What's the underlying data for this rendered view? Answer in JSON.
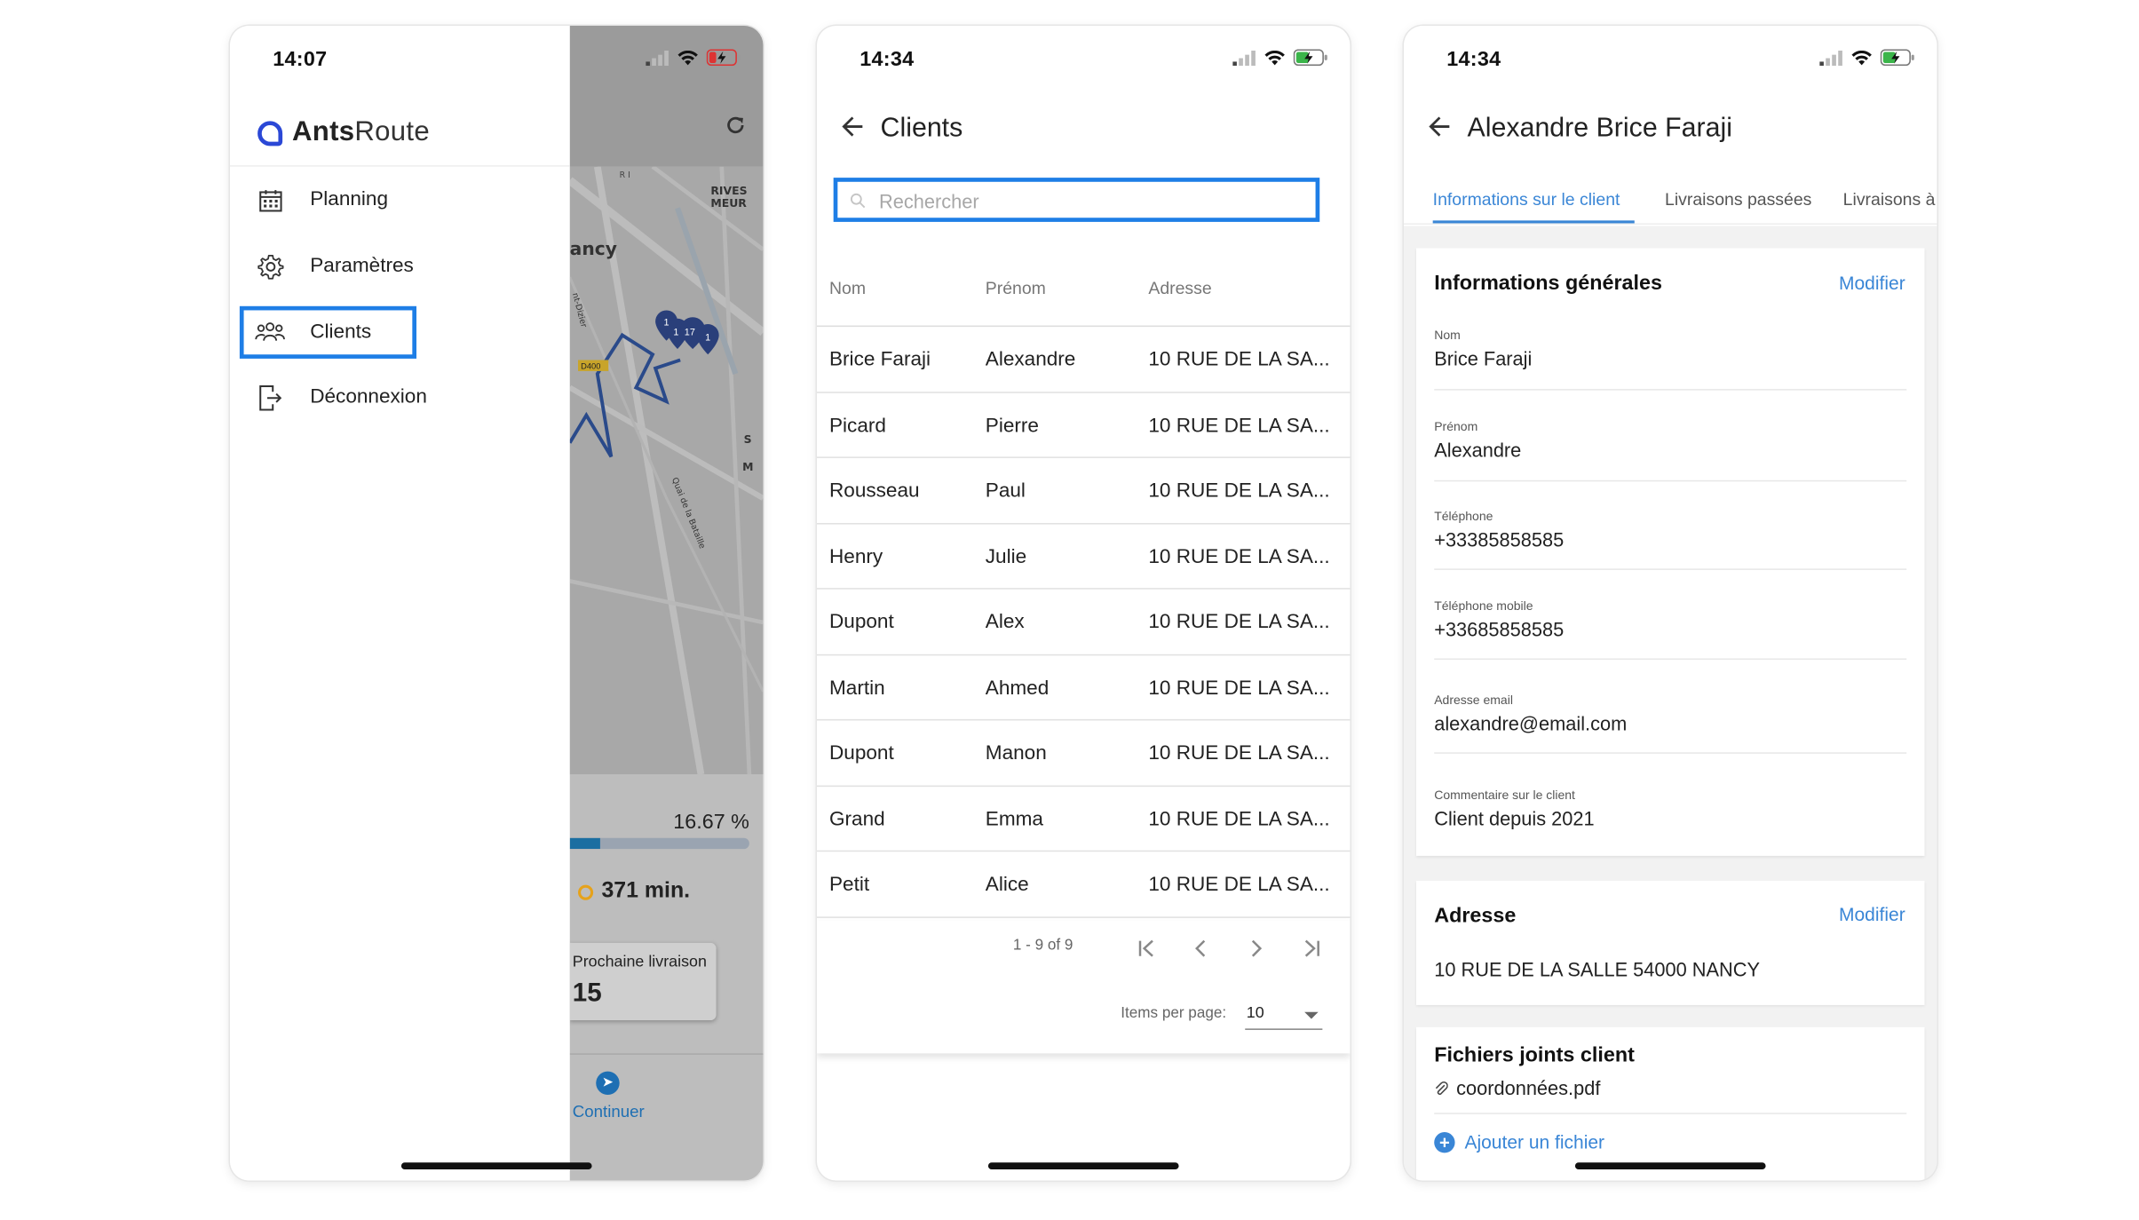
{
  "phone1": {
    "status": {
      "time": "14:07"
    },
    "app": {
      "logo_bold": "Ants",
      "logo_regular": "Route"
    },
    "menu": [
      {
        "label": "Planning",
        "icon": "calendar-icon"
      },
      {
        "label": "Paramètres",
        "icon": "gear-icon"
      },
      {
        "label": "Clients",
        "icon": "users-icon",
        "active": true
      },
      {
        "label": "Déconnexion",
        "icon": "logout-icon"
      }
    ],
    "map": {
      "labels": {
        "city": "ancy",
        "district_1": "RIVES",
        "district_2": "MEUR",
        "road": "D400",
        "street": "Quai de la Bataille",
        "street2": "nt-Dizier",
        "side_1": "S",
        "side_2": "M",
        "corner": "R I"
      },
      "markers": [
        "1",
        "1",
        "17",
        "1"
      ]
    },
    "summary": {
      "progress_text": "16.67 %",
      "progress_fraction": 0.1667,
      "duration": "371 min.",
      "next_delivery_label": "Prochaine livraison",
      "next_delivery_value": "15",
      "continue_label": "Continuer"
    }
  },
  "phone2": {
    "status": {
      "time": "14:34"
    },
    "title": "Clients",
    "search": {
      "placeholder": "Rechercher"
    },
    "columns": {
      "nom": "Nom",
      "prenom": "Prénom",
      "adresse": "Adresse"
    },
    "rows": [
      {
        "nom": "Brice Faraji",
        "prenom": "Alexandre",
        "adresse": "10 RUE DE LA SA..."
      },
      {
        "nom": "Picard",
        "prenom": "Pierre",
        "adresse": "10 RUE DE LA SA..."
      },
      {
        "nom": "Rousseau",
        "prenom": "Paul",
        "adresse": "10 RUE DE LA SA..."
      },
      {
        "nom": "Henry",
        "prenom": "Julie",
        "adresse": "10 RUE DE LA SA..."
      },
      {
        "nom": "Dupont",
        "prenom": "Alex",
        "adresse": "10 RUE DE LA SA..."
      },
      {
        "nom": "Martin",
        "prenom": "Ahmed",
        "adresse": "10 RUE DE LA SA..."
      },
      {
        "nom": "Dupont",
        "prenom": "Manon",
        "adresse": "10 RUE DE LA SA..."
      },
      {
        "nom": "Grand",
        "prenom": "Emma",
        "adresse": "10 RUE DE LA SA..."
      },
      {
        "nom": "Petit",
        "prenom": "Alice",
        "adresse": "10 RUE DE LA SA..."
      }
    ],
    "paginator": {
      "range": "1 - 9 of 9",
      "items_per_page_label": "Items per page:",
      "items_per_page": "10"
    }
  },
  "phone3": {
    "status": {
      "time": "14:34"
    },
    "title": "Alexandre Brice Faraji",
    "tabs": [
      {
        "label": "Informations sur le client",
        "active": true
      },
      {
        "label": "Livraisons passées"
      },
      {
        "label": "Livraisons à"
      }
    ],
    "general": {
      "title": "Informations générales",
      "action": "Modifier",
      "fields": [
        {
          "label": "Nom",
          "value": "Brice Faraji"
        },
        {
          "label": "Prénom",
          "value": "Alexandre"
        },
        {
          "label": "Téléphone",
          "value": "+33385858585"
        },
        {
          "label": "Téléphone mobile",
          "value": "+33685858585"
        },
        {
          "label": "Adresse email",
          "value": "alexandre@email.com"
        },
        {
          "label": "Commentaire sur le client",
          "value": "Client depuis 2021"
        }
      ]
    },
    "address": {
      "title": "Adresse",
      "action": "Modifier",
      "value": "10 RUE DE LA SALLE 54000 NANCY"
    },
    "files": {
      "title": "Fichiers joints client",
      "file": "coordonnées.pdf",
      "add_label": "Ajouter un fichier"
    }
  },
  "colors": {
    "accent": "#1e7ee6",
    "link": "#3a86d6",
    "logo": "#2b48d6",
    "progress": "#1b6ea1",
    "route": "#2a4a8a",
    "marker": "#2a3f7a"
  }
}
